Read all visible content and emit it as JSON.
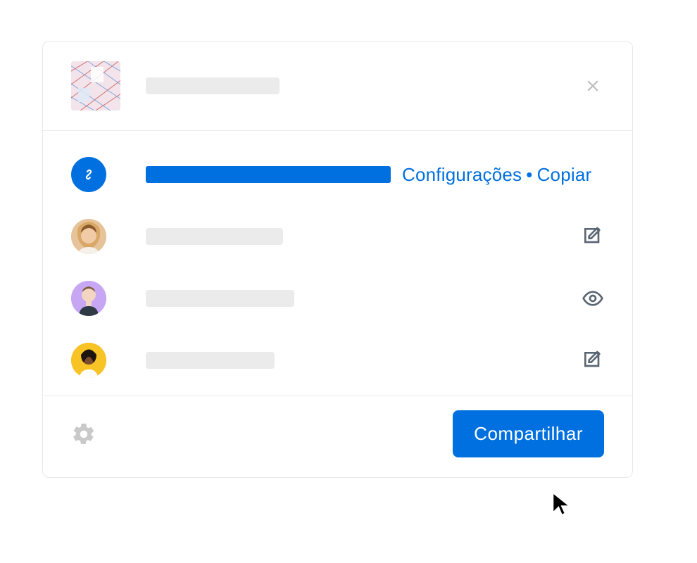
{
  "link_actions": {
    "settings_label": "Configurações",
    "copy_label": "Copiar",
    "separator": "•"
  },
  "members": [
    {
      "avatar_bg": "#e9c08d",
      "name_width": 195,
      "permission": "edit"
    },
    {
      "avatar_bg": "#c7a7f4",
      "name_width": 211,
      "permission": "view"
    },
    {
      "avatar_bg": "#f7c325",
      "name_width": 183,
      "permission": "edit"
    }
  ],
  "share_button_label": "Compartilhar",
  "link_bar_width": 348,
  "colors": {
    "primary": "#0070e0",
    "skeleton": "#ebebeb"
  }
}
